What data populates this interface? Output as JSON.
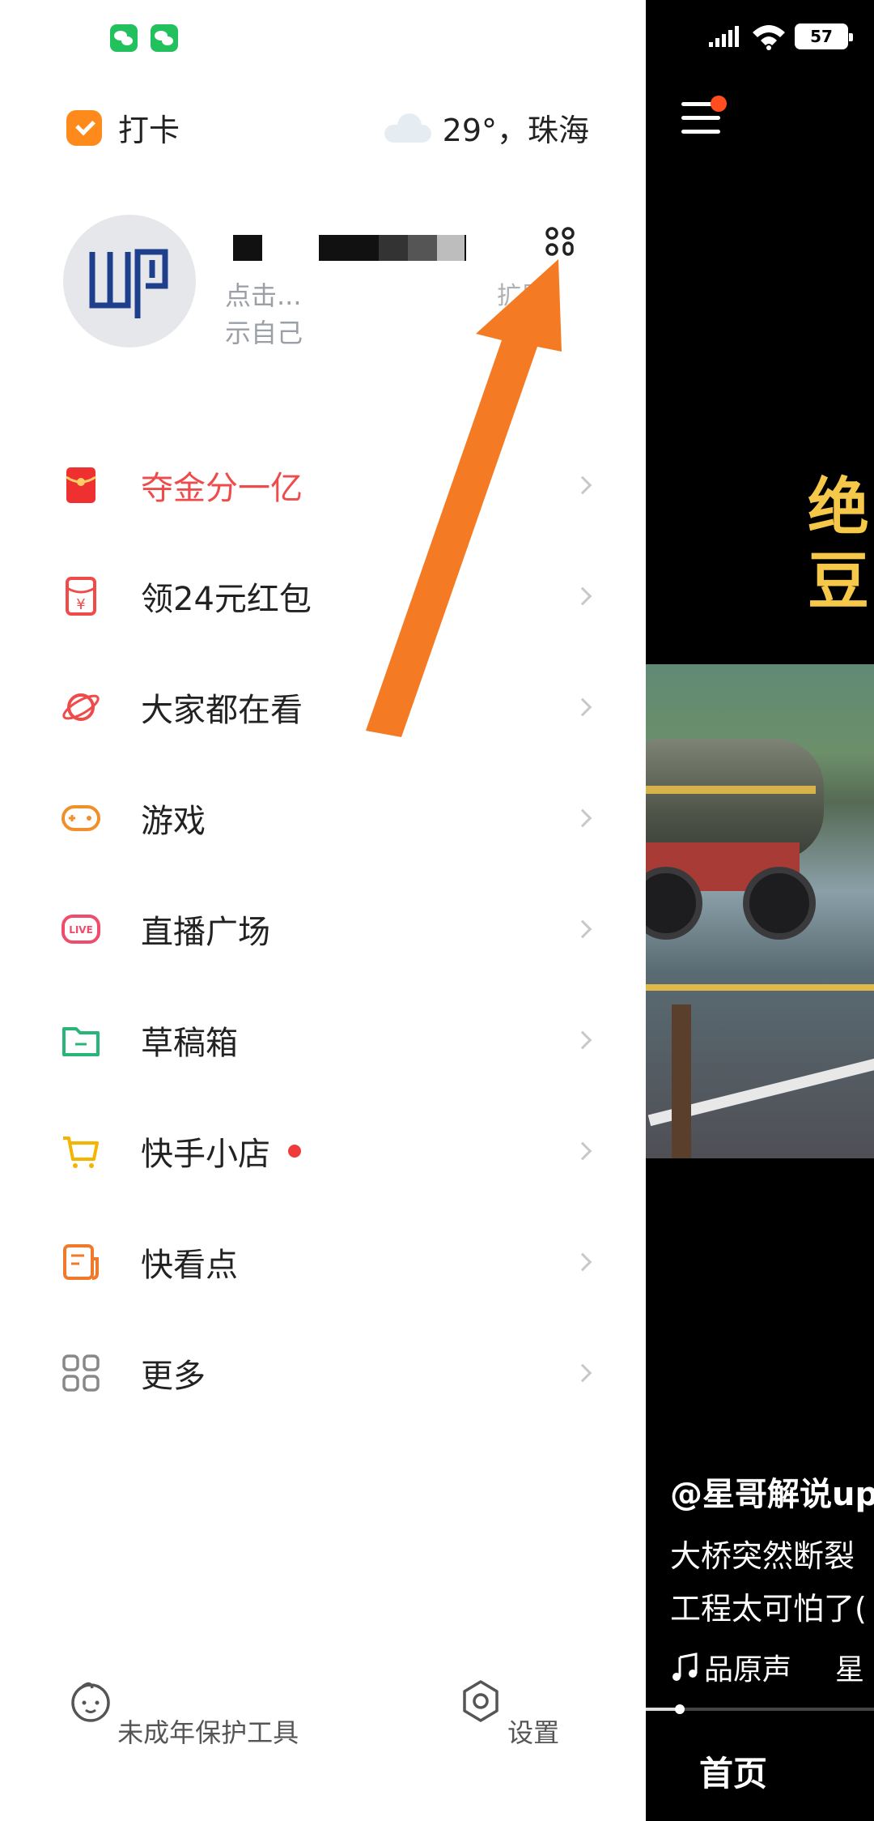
{
  "drawer": {
    "checkin_label": "打卡",
    "weather_text": "29°，珠海",
    "profile": {
      "sub_line1": "点击...",
      "sub_line2": "示自己",
      "expand_label": "扩展"
    },
    "menu": [
      {
        "label": "夺金分一亿",
        "icon": "red-envelope-icon",
        "highlight": true
      },
      {
        "label": "领24元红包",
        "icon": "coupon-icon"
      },
      {
        "label": "大家都在看",
        "icon": "planet-icon"
      },
      {
        "label": "游戏",
        "icon": "gamepad-icon"
      },
      {
        "label": "直播广场",
        "icon": "live-icon"
      },
      {
        "label": "草稿箱",
        "icon": "folder-icon"
      },
      {
        "label": "快手小店",
        "icon": "cart-icon",
        "badge": true
      },
      {
        "label": "快看点",
        "icon": "news-icon"
      },
      {
        "label": "更多",
        "icon": "grid-icon"
      }
    ],
    "bottom_tools": {
      "minor_protect_label": "未成年保护工具",
      "settings_label": "设置"
    }
  },
  "video_panel": {
    "battery": "57",
    "title_line1": "绝",
    "title_line2": "豆",
    "author": "@星哥解说up",
    "desc_line1": "大桥突然断裂",
    "desc_line2": "工程太可怕了(",
    "music_name": "品原声",
    "music_name2": "星",
    "progress": 0.15,
    "nav_home": "首页"
  },
  "colors": {
    "accent_red": "#ef4b4b",
    "orange": "#ff8a1c",
    "arrow": "#f47a24",
    "wechat": "#22c15e"
  }
}
